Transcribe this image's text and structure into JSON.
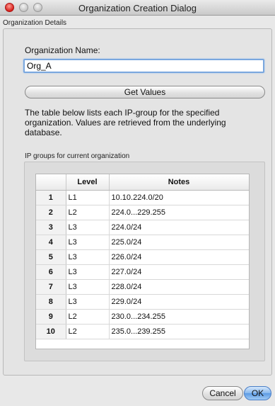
{
  "window": {
    "title": "Organization Creation Dialog"
  },
  "section": {
    "label": "Organization Details"
  },
  "org": {
    "label": "Organization Name:",
    "value": "Org_A"
  },
  "buttons": {
    "get_values": "Get Values",
    "cancel": "Cancel",
    "ok": "OK"
  },
  "description": "The table below lists each IP-group for the specified organization. Values are retrieved from the underlying database.",
  "table": {
    "label": "IP groups for current organization",
    "headers": [
      "",
      "Level",
      "Notes"
    ],
    "rows": [
      [
        "1",
        "L1",
        "10.10.224.0/20"
      ],
      [
        "2",
        "L2",
        "224.0...229.255"
      ],
      [
        "3",
        "L3",
        "224.0/24"
      ],
      [
        "4",
        "L3",
        "225.0/24"
      ],
      [
        "5",
        "L3",
        "226.0/24"
      ],
      [
        "6",
        "L3",
        "227.0/24"
      ],
      [
        "7",
        "L3",
        "228.0/24"
      ],
      [
        "8",
        "L3",
        "229.0/24"
      ],
      [
        "9",
        "L2",
        "230.0...234.255"
      ],
      [
        "10",
        "L2",
        "235.0...239.255"
      ]
    ]
  },
  "colors": {
    "accent": "#5c9ae4",
    "focus_ring": "#7aa7de",
    "close_button": "#d6201a"
  }
}
